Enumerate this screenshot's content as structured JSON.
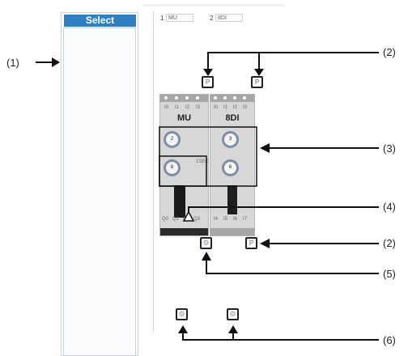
{
  "panel": {
    "header": "Select"
  },
  "slots": [
    {
      "index": "1",
      "value": "MU"
    },
    {
      "index": "2",
      "value": "8DI"
    }
  ],
  "modules": [
    {
      "name": "MU",
      "inputs": [
        "I0",
        "I1",
        "I2",
        "I3"
      ],
      "outputs": [
        "Q0",
        "Q1",
        "Q2",
        "Q3"
      ],
      "dial_top": "2",
      "dial_bottom": "8",
      "dial_bottom_unit": "1SEC"
    },
    {
      "name": "8DI",
      "inputs": [
        "I0",
        "I1",
        "I2",
        "I3"
      ],
      "outputs": [
        "I4",
        "I5",
        "I6",
        "I7"
      ],
      "dial_top": "3",
      "dial_bottom": "6"
    }
  ],
  "buttons": {
    "p_label": "P",
    "gear_glyph": "⚙"
  },
  "callouts": [
    "(1)",
    "(2)",
    "(3)",
    "(4)",
    "(2)",
    "(5)",
    "(6)"
  ],
  "colors": {
    "header_bg": "#2f7fc1",
    "dial_ring": "#7d8ea5",
    "module_body": "#d7d7d7"
  }
}
